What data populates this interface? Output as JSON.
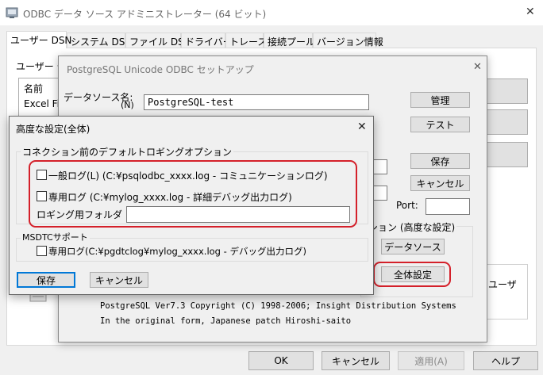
{
  "main_window": {
    "title": "ODBC データ ソース アドミニストレーター (64 ビット)",
    "tabs": [
      "ユーザー DSN",
      "システム DSN",
      "ファイル DSN",
      "ドライバー",
      "トレース",
      "接続プール",
      "バージョン情報"
    ],
    "section_label": "ユーザー デ",
    "list_header": "名前",
    "list_item": "Excel Fi",
    "right_text": "ユーザ",
    "buttons": {
      "ok": "OK",
      "cancel": "キャンセル",
      "apply": "適用(A)",
      "help": "ヘルプ"
    }
  },
  "setup_dialog": {
    "title": "PostgreSQL Unicode ODBC セットアップ",
    "datasource_label": "データソース名:",
    "datasource_hotkey": "(N)",
    "datasource_value": "PostgreSQL-test",
    "buttons": {
      "manage": "管理",
      "test": "テスト",
      "save": "保存",
      "cancel": "キャンセル",
      "datasource": "データソース",
      "global": "全体設定"
    },
    "port_label": "Port:",
    "option_label": "ション (高度な設定)",
    "copyright_line1": "PostgreSQL Ver7.3  Copyright (C) 1998-2006; Insight Distribution Systems",
    "copyright_line2": "In the original form, Japanese patch Hiroshi-saito"
  },
  "advanced_dialog": {
    "title": "高度な設定(全体)",
    "close_glyph": "✕",
    "logging_group": "コネクション前のデフォルトロギングオプション",
    "general_log": "一般ログ(L) (C:¥psqlodbc_xxxx.log - コミュニケーションログ)",
    "debug_log": "専用ログ (C:¥mylog_xxxx.log - 詳細デバッグ出力ログ)",
    "folder_label": "ロギング用フォルダ",
    "folder_value": "",
    "msdtc_group": "MSDTCサポート",
    "msdtc_log": "専用ログ(C:¥pgdtclog¥mylog_xxxx.log - デバッグ出力ログ)",
    "save_button": "保存",
    "cancel_button": "キャンセル"
  }
}
